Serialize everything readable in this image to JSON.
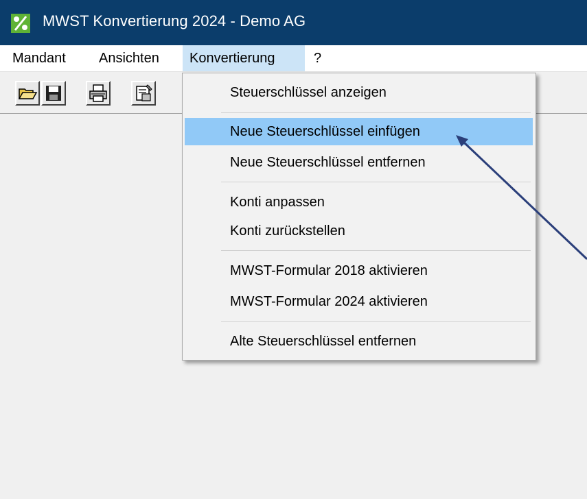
{
  "window": {
    "title": "MWST Konvertierung 2024 - Demo AG",
    "icon": "app-percent-icon"
  },
  "menubar": {
    "items": [
      {
        "label": "Mandant"
      },
      {
        "label": "Ansichten"
      },
      {
        "label": "Konvertierung"
      },
      {
        "label": "?"
      }
    ],
    "active": "Konvertierung"
  },
  "toolbar": {
    "buttons": [
      {
        "icon": "open-folder-icon"
      },
      {
        "icon": "save-icon"
      },
      {
        "icon": "print-icon"
      },
      {
        "icon": "properties-icon"
      }
    ]
  },
  "dropdown": {
    "items": [
      {
        "label": "Steuerschlüssel anzeigen"
      },
      {
        "label": "Neue Steuerschlüssel einfügen"
      },
      {
        "label": "Neue Steuerschlüssel entfernen"
      },
      {
        "label": "Konti anpassen"
      },
      {
        "label": "Konti zurückstellen"
      },
      {
        "label": "MWST-Formular 2018 aktivieren"
      },
      {
        "label": "MWST-Formular 2024 aktivieren"
      },
      {
        "label": "Alte Steuerschlüssel entfernen"
      }
    ],
    "highlighted": "Neue Steuerschlüssel einfügen"
  },
  "colors": {
    "titlebar": "#0b3d6b",
    "highlight": "#91c9f7",
    "menu_active": "#cce4f7",
    "annotation_arrow": "#2b3f7a"
  }
}
